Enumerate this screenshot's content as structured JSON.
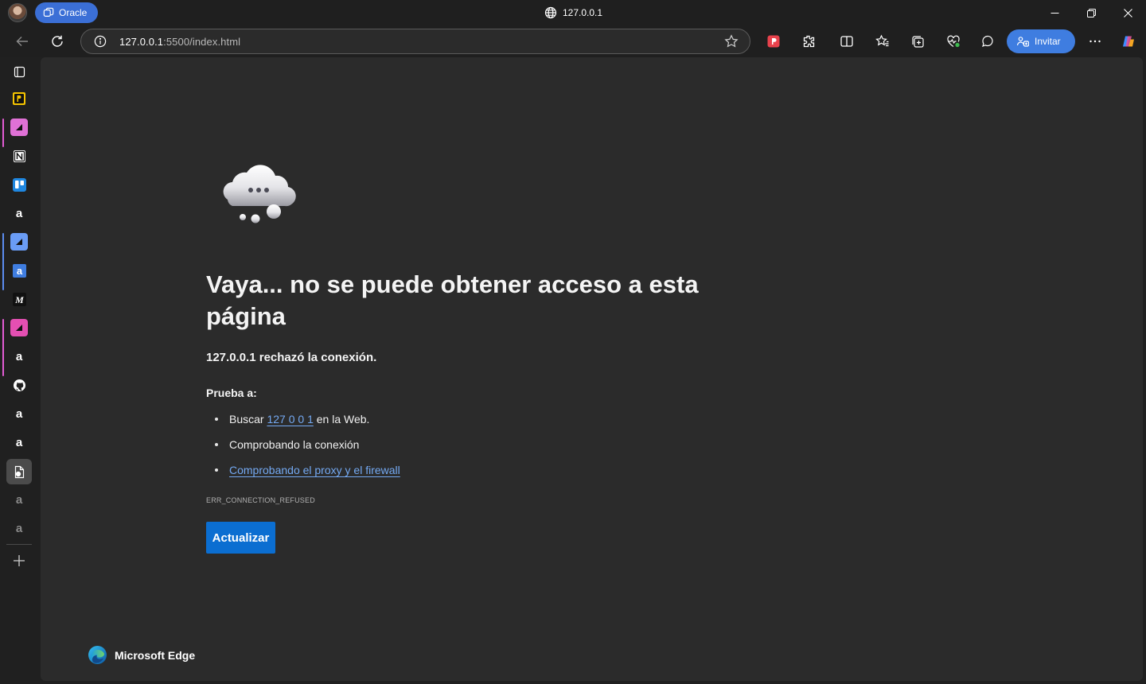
{
  "titlebar": {
    "profile_label": "Oracle",
    "page_title": "127.0.0.1"
  },
  "toolbar": {
    "url_host": "127.0.0.1",
    "url_path": ":5500/index.html",
    "invite_label": "Invitar"
  },
  "sidebar": {
    "items": [
      {
        "icon": "tab-actions-icon"
      },
      {
        "icon": "p-app-icon"
      },
      {
        "icon": "pink-app-icon"
      },
      {
        "icon": "notion-icon"
      },
      {
        "icon": "trello-icon"
      },
      {
        "icon": "amazon-icon"
      },
      {
        "icon": "blue-app-icon"
      },
      {
        "icon": "amazon-blue-icon"
      },
      {
        "icon": "m-app-icon"
      },
      {
        "icon": "pink-app-icon"
      },
      {
        "icon": "amazon-icon"
      },
      {
        "icon": "github-icon"
      },
      {
        "icon": "amazon-icon"
      },
      {
        "icon": "amazon-icon"
      },
      {
        "icon": "active-app-icon"
      },
      {
        "icon": "amazon-icon"
      },
      {
        "icon": "amazon-icon"
      },
      {
        "icon": "add-icon"
      }
    ]
  },
  "error_page": {
    "heading": "Vaya... no se puede obtener acceso a esta página",
    "subheading_host": "127.0.0.1",
    "subheading_rest": " rechazó la conexión.",
    "try_label": "Prueba a:",
    "suggestions": {
      "search_prefix": "Buscar ",
      "search_link": "127 0 0 1",
      "search_suffix": " en la Web.",
      "check_connection": "Comprobando la conexión",
      "check_proxy": "Comprobando el proxy y el firewall"
    },
    "error_code": "ERR_CONNECTION_REFUSED",
    "refresh_button": "Actualizar"
  },
  "footer": {
    "brand": "Microsoft Edge"
  },
  "colors": {
    "accent": "#0b6ed1",
    "link": "#74a9f2",
    "profile_pill": "#3b6fd6",
    "background": "#2b2b2b"
  }
}
